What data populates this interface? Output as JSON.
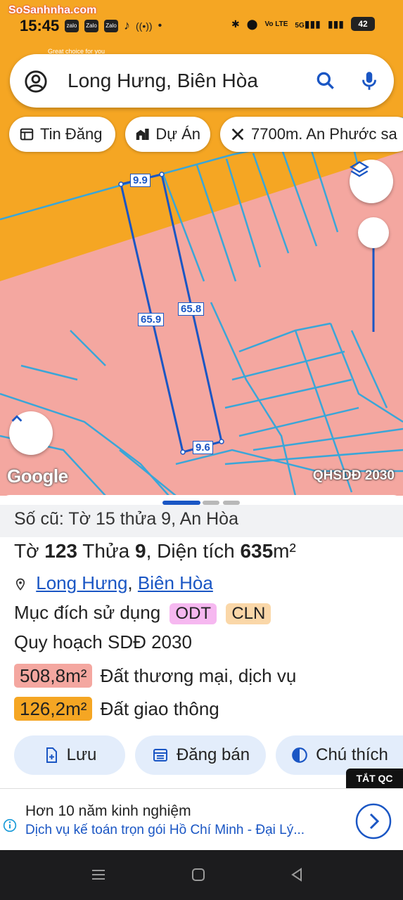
{
  "status_bar": {
    "time": "15:45",
    "watermark": "SoSanhnha.com",
    "watermark_sub": "Great choice for you",
    "app_icons": [
      "zalo",
      "Zalo",
      "Zalo",
      "tiktok"
    ],
    "network": "5G",
    "network2": "Vo LTE",
    "battery": "42"
  },
  "search": {
    "query": "Long Hưng, Biên Hòa"
  },
  "chips": [
    {
      "label": "Tin Đăng",
      "icon": "listing-icon"
    },
    {
      "label": "Dự Án",
      "icon": "building-icon"
    },
    {
      "label": "7700m. An Phước sa",
      "icon": "ruler-icon"
    }
  ],
  "map": {
    "dimensions": {
      "top": "9.9",
      "left": "65.9",
      "right": "65.8",
      "bottom": "9.6"
    },
    "attribution": "Google",
    "layer_label": "QHSDĐ 2030",
    "colors": {
      "land_orange": "#f5a623",
      "land_pink": "#f4a7a0",
      "parcel_lines": "#3aa6d8",
      "selected_parcel": "#1a56c4"
    }
  },
  "sheet": {
    "old_parcel": "Số cũ: Tờ 15 thửa 9, An Hòa",
    "to_label": "Tờ",
    "to_value": "123",
    "thua_label": "Thửa",
    "thua_value": "9",
    "area_label": "Diện tích",
    "area_value": "635",
    "area_unit": "m²",
    "location_ward": "Long Hưng",
    "location_separator": ",",
    "location_city": "Biên Hòa",
    "purpose_label": "Mục đích sử dụng",
    "purpose_tags": [
      {
        "code": "ODT",
        "color": "#f6b8f0"
      },
      {
        "code": "CLN",
        "color": "#fad7a8"
      }
    ],
    "plan_label": "Quy hoạch SDĐ 2030",
    "plan_items": [
      {
        "area": "508,8m²",
        "label": "Đất thương mại, dịch vụ",
        "color": "#f4a7a0"
      },
      {
        "area": "126,2m²",
        "label": "Đất giao thông",
        "color": "#f5a623"
      }
    ],
    "actions": [
      {
        "label": "Lưu",
        "icon": "add-file-icon"
      },
      {
        "label": "Đăng bán",
        "icon": "calendar-list-icon"
      },
      {
        "label": "Chú thích",
        "icon": "contrast-icon"
      }
    ]
  },
  "ad": {
    "close_label": "TẮT QC",
    "title": "Hơn 10 năm kinh nghiệm",
    "subtitle": "Dịch vụ kế toán trọn gói Hồ Chí Minh - Đại Lý..."
  }
}
